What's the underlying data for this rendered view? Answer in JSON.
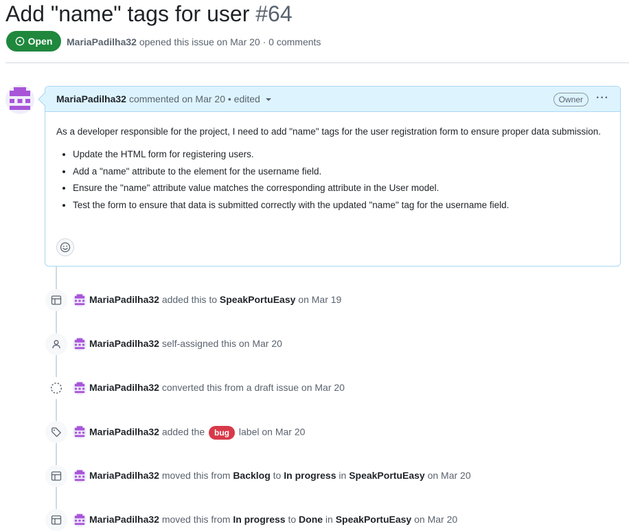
{
  "issue": {
    "title": "Add \"name\" tags for user",
    "number": "#64",
    "state": "Open",
    "author": "MariaPadilha32",
    "opened_text": " opened this issue on Mar 20 · 0 comments"
  },
  "comment": {
    "author": "MariaPadilha32",
    "meta": "commented on Mar 20 • edited",
    "role_badge": "Owner",
    "menu_icon": "kebab-horizontal-icon",
    "intro": "As a developer responsible for the project, I need to add \"name\" tags for the user registration form to ensure proper data submission.",
    "items": [
      "Update the HTML form for registering users.",
      "Add a \"name\" attribute to the element for the username field.",
      "Ensure the \"name\" attribute value matches the corresponding attribute in the User model.",
      "Test the form to ensure that data is submitted correctly with the updated \"name\" tag for the username field."
    ],
    "reaction_icon": "smiley-icon"
  },
  "timeline": [
    {
      "icon": "project-table-icon",
      "actor": "MariaPadilha32",
      "t1": " added this to ",
      "b1": "SpeakPortuEasy",
      "t2": " on Mar 19"
    },
    {
      "icon": "person-icon",
      "actor": "MariaPadilha32",
      "t1": " self-assigned this on Mar 20"
    },
    {
      "icon": "draft-issue-icon",
      "actor": "MariaPadilha32",
      "t1": " converted this from a draft issue on Mar 20"
    },
    {
      "icon": "tag-icon",
      "actor": "MariaPadilha32",
      "t1": " added the ",
      "label": "bug",
      "t2": " label on Mar 20"
    },
    {
      "icon": "project-table-icon",
      "actor": "MariaPadilha32",
      "t1": " moved this from ",
      "b1": "Backlog",
      "t2": " to ",
      "b2": "In progress",
      "t3": " in ",
      "b3": "SpeakPortuEasy",
      "t4": " on Mar 20"
    },
    {
      "icon": "project-table-icon",
      "actor": "MariaPadilha32",
      "t1": " moved this from ",
      "b1": "In progress",
      "t2": " to ",
      "b2": "Done",
      "t3": " in ",
      "b3": "SpeakPortuEasy",
      "t4": " on Mar 20"
    }
  ],
  "colors": {
    "open_green": "#1f883d",
    "comment_header_bg": "#ddf4ff",
    "comment_border": "#a8d6f4",
    "bug_label": "#d73a4a",
    "avatar_purple": "#a855d8"
  }
}
